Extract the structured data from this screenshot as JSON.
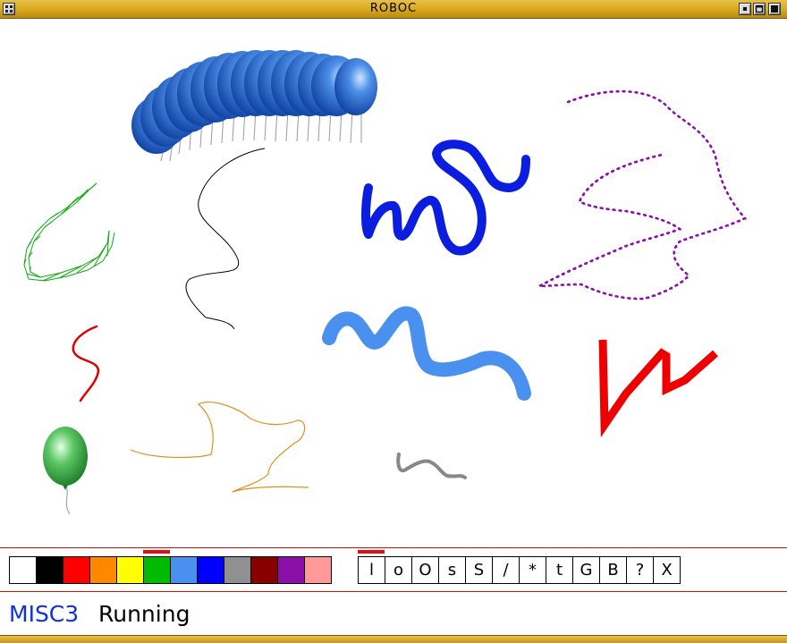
{
  "window": {
    "title": "ROBOC",
    "menu_icon": "window-menu-icon",
    "iconify_icon": "iconify-icon",
    "maximize_icon": "maximize-icon",
    "close_icon": "close-icon"
  },
  "canvas": {
    "strokes": [
      {
        "name": "green-zigzag-ribbon-stroke",
        "color": "#11aa11",
        "brush": "triangle-ribbon"
      },
      {
        "name": "black-thin-stroke",
        "color": "#000000",
        "brush": "thin"
      },
      {
        "name": "blue-thick-stroke",
        "color": "#0b1ee0",
        "brush": "thick"
      },
      {
        "name": "purple-star-stroke",
        "color": "#8a0fa8",
        "brush": "star"
      },
      {
        "name": "red-thin-stroke",
        "color": "#e00000",
        "brush": "thin"
      },
      {
        "name": "light-blue-thick-stroke",
        "color": "#4a90ee",
        "brush": "very-thick"
      },
      {
        "name": "red-square-stroke",
        "color": "#ee0000",
        "brush": "square"
      },
      {
        "name": "orange-thin-stroke",
        "color": "#e09020",
        "brush": "thin"
      },
      {
        "name": "gray-medium-stroke",
        "color": "#888888",
        "brush": "medium"
      }
    ],
    "stamps": [
      {
        "name": "blue-balloon-caterpillar-stamp",
        "color": "#2a6fd8"
      },
      {
        "name": "green-balloon-stamp",
        "color": "#3db34a"
      }
    ]
  },
  "palette": {
    "colors": [
      "#ffffff",
      "#000000",
      "#ff0000",
      "#ff8800",
      "#ffff00",
      "#00bb00",
      "#4a90ee",
      "#0000ff",
      "#909090",
      "#880000",
      "#8a0fa8",
      "#ff9999"
    ],
    "selected_index": 5
  },
  "brushes": {
    "labels": [
      "l",
      "o",
      "O",
      "s",
      "S",
      "/",
      "*",
      "t",
      "G",
      "B",
      "?",
      "X"
    ],
    "selected_index": 0
  },
  "status": {
    "name": "MISC3",
    "state": "Running"
  }
}
